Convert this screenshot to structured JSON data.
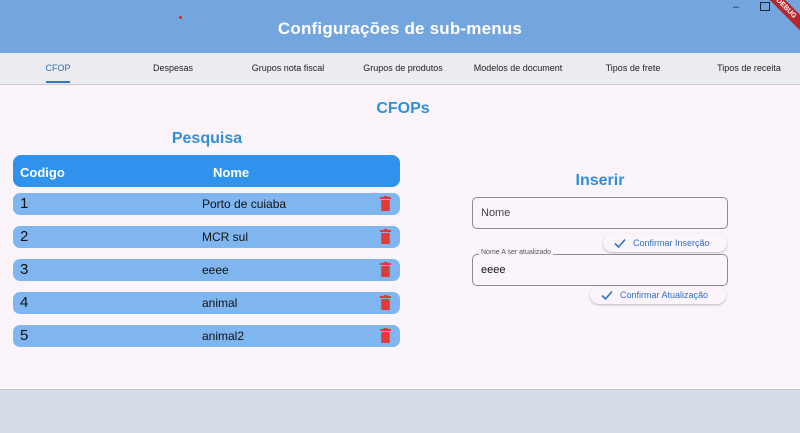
{
  "appbar": {
    "title": "Configurações de sub-menus",
    "debug_banner": "DEBUG"
  },
  "window": {
    "minimize_glyph": "–"
  },
  "tabs": [
    {
      "label": "CFOP",
      "active": true
    },
    {
      "label": "Despesas"
    },
    {
      "label": "Grupos nota fiscal"
    },
    {
      "label": "Grupos de produtos"
    },
    {
      "label": "Modelos de document"
    },
    {
      "label": "Tipos de frete"
    },
    {
      "label": "Tipos de receita"
    }
  ],
  "page": {
    "title": "CFOPs"
  },
  "search": {
    "title": "Pesquisa",
    "columns": {
      "code": "Codigo",
      "name": "Nome"
    },
    "rows": [
      {
        "code": "1",
        "name": "Porto de cuiaba"
      },
      {
        "code": "2",
        "name": "MCR sul"
      },
      {
        "code": "3",
        "name": "eeee"
      },
      {
        "code": "4",
        "name": "animal"
      },
      {
        "code": "5",
        "name": "animal2"
      }
    ]
  },
  "insert": {
    "title": "Inserir",
    "name_placeholder": "Nome",
    "confirm_insert_label": "Confirmar Inserção",
    "update_field_label": "Nome A ser atualizado",
    "update_field_value": "eeee",
    "confirm_update_label": "Confirmar Atualização"
  },
  "colors": {
    "appbar": "#73a6de",
    "accent": "#2f92ec",
    "row": "#7fb6ef",
    "delete": "#e53935",
    "heading": "#2f8fdb"
  }
}
